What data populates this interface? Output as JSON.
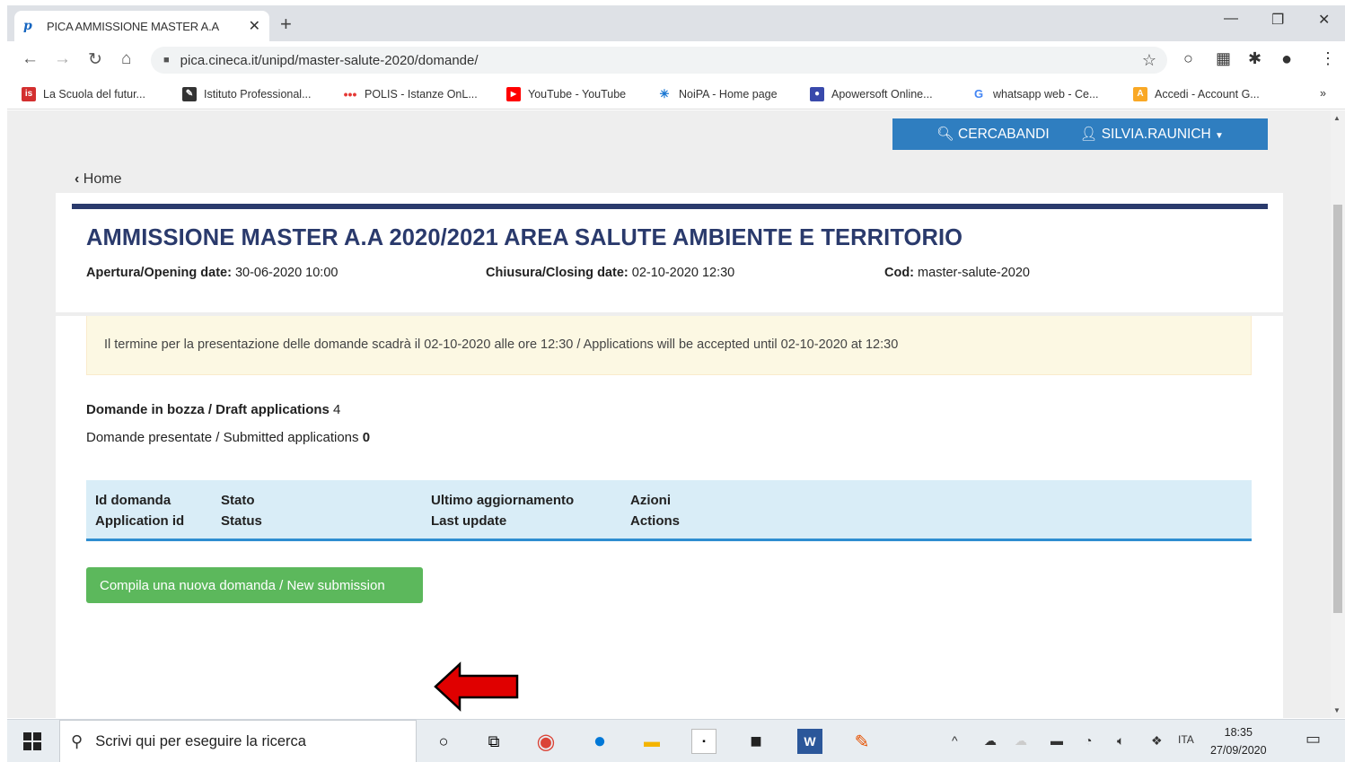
{
  "browser": {
    "tab_title": "PICA AMMISSIONE MASTER A.A",
    "url": "pica.cineca.it/unipd/master-salute-2020/domande/",
    "bookmarks": [
      {
        "label": "La Scuola del futur...",
        "color": "#d32f2f",
        "icon": "is"
      },
      {
        "label": "Istituto Professional...",
        "color": "#333333",
        "icon": "✎"
      },
      {
        "label": "POLIS - Istanze OnL...",
        "color": "#e53935",
        "icon": "•"
      },
      {
        "label": "YouTube - YouTube",
        "color": "#ff0000",
        "icon": "▶"
      },
      {
        "label": "NoiPA - Home page",
        "color": "#1976d2",
        "icon": "✳"
      },
      {
        "label": "Apowersoft Online...",
        "color": "#3949ab",
        "icon": "●"
      },
      {
        "label": "whatsapp web - Ce...",
        "color": "#ffffff",
        "icon": "G"
      },
      {
        "label": "Accedi - Account G...",
        "color": "#f9a825",
        "icon": "A"
      }
    ]
  },
  "header": {
    "search_label": "CERCABANDI",
    "user_label": "SILVIA.RAUNICH"
  },
  "breadcrumb": {
    "home_label": "Home"
  },
  "call": {
    "title": "AMMISSIONE MASTER A.A 2020/2021 AREA SALUTE AMBIENTE E TERRITORIO",
    "opening_label": "Apertura/Opening date:",
    "opening_value": "30-06-2020 10:00",
    "closing_label": "Chiusura/Closing date:",
    "closing_value": "02-10-2020 12:30",
    "code_label": "Cod:",
    "code_value": "master-salute-2020"
  },
  "alert": {
    "text": "Il termine per la presentazione delle domande scadrà il 02-10-2020 alle ore 12:30 / Applications will be accepted until 02-10-2020 at 12:30"
  },
  "counts": {
    "draft_label": "Domande in bozza / Draft applications",
    "draft_value": "4",
    "submitted_label": "Domande presentate / Submitted applications",
    "submitted_value": "0"
  },
  "table": {
    "columns": [
      {
        "it": "Id domanda",
        "en": "Application id"
      },
      {
        "it": "Stato",
        "en": "Status"
      },
      {
        "it": "Ultimo aggiornamento",
        "en": "Last update"
      },
      {
        "it": "Azioni",
        "en": "Actions"
      }
    ]
  },
  "new_submission_label": "Compila una nuova domanda / New submission",
  "taskbar": {
    "search_placeholder": "Scrivi qui per eseguire la ricerca",
    "language": "ITA",
    "time": "18:35",
    "date": "27/09/2020"
  },
  "colors": {
    "accent_blue": "#2f7ec0",
    "title_navy": "#2a3a6c",
    "success_green": "#5cb85c",
    "arrow_red": "#e00000"
  }
}
